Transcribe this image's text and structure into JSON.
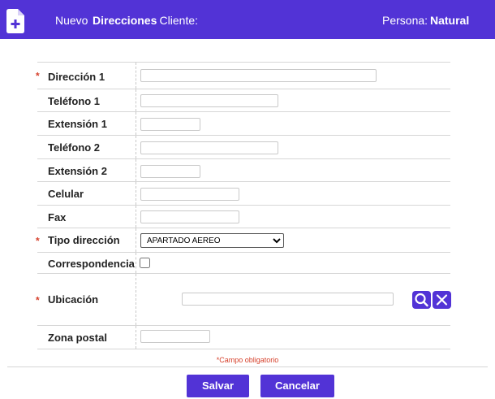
{
  "header": {
    "prefix": "Nuevo",
    "entity": "Direcciones",
    "client_label": "- Cliente:",
    "person_label": "Persona:",
    "person_value": "Natural",
    "icon": "new-document-icon",
    "accent": "#5233d6"
  },
  "form": {
    "address1_label": "Dirección 1",
    "phone1_label": "Teléfono 1",
    "ext1_label": "Extensión 1",
    "phone2_label": "Teléfono 2",
    "ext2_label": "Extensión 2",
    "mobile_label": "Celular",
    "fax_label": "Fax",
    "address_type_label": "Tipo dirección",
    "address_type_selected": "APARTADO AEREO",
    "correspondence_label": "Correspondencia",
    "location_label": "Ubicación",
    "zip_label": "Zona postal",
    "required_marker": "*",
    "required_note": "*Campo obligatorio"
  },
  "buttons": {
    "save": "Salvar",
    "cancel": "Cancelar",
    "search_icon": "search-icon",
    "clear_icon": "close-icon"
  }
}
